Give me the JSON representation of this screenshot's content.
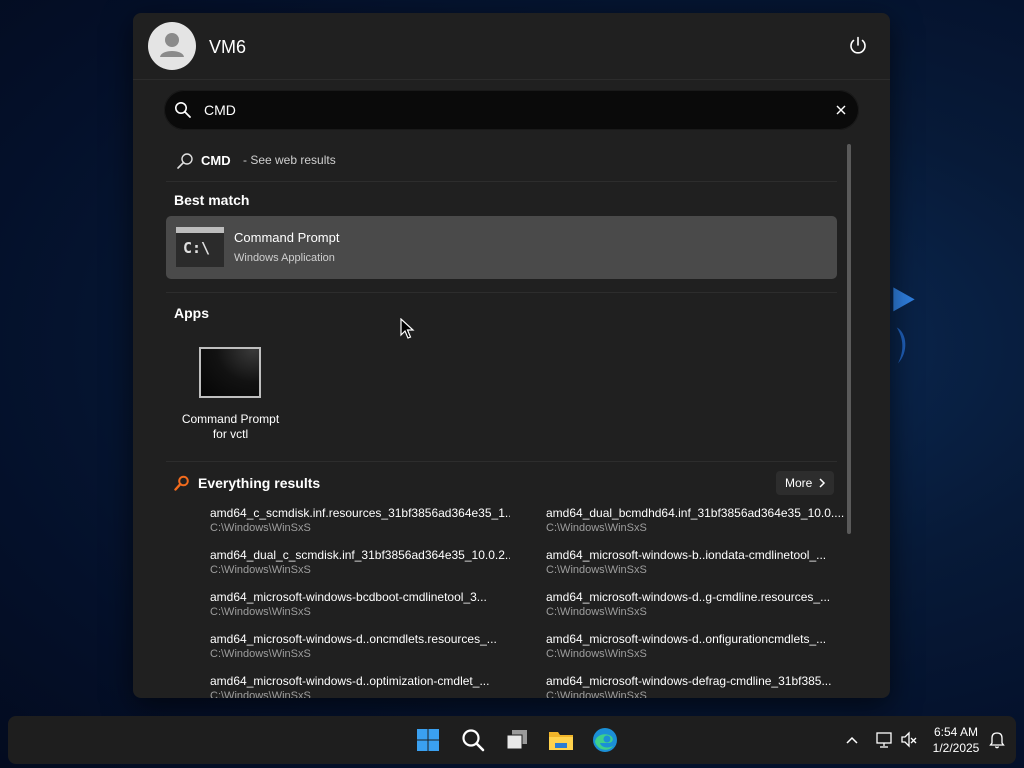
{
  "start_menu": {
    "username": "VM6",
    "search": {
      "query": "CMD"
    },
    "web_result": {
      "term": "CMD",
      "suffix": "- See web results"
    },
    "best_match": {
      "title": "Best match",
      "name": "Command Prompt",
      "type": "Windows Application",
      "icon_glyph": "C:\\"
    },
    "apps": {
      "title": "Apps",
      "items": [
        {
          "line1": "Command Prompt",
          "line2": "for vctl"
        }
      ]
    },
    "everything": {
      "title": "Everything results",
      "more_label": "More",
      "results": [
        {
          "name": "amd64_c_scmdisk.inf.resources_31bf3856ad364e35_1...",
          "path": "C:\\Windows\\WinSxS"
        },
        {
          "name": "amd64_dual_bcmdhd64.inf_31bf3856ad364e35_10.0....",
          "path": "C:\\Windows\\WinSxS"
        },
        {
          "name": "amd64_dual_c_scmdisk.inf_31bf3856ad364e35_10.0.2...",
          "path": "C:\\Windows\\WinSxS"
        },
        {
          "name": "amd64_microsoft-windows-b..iondata-cmdlinetool_...",
          "path": "C:\\Windows\\WinSxS"
        },
        {
          "name": "amd64_microsoft-windows-bcdboot-cmdlinetool_3...",
          "path": "C:\\Windows\\WinSxS"
        },
        {
          "name": "amd64_microsoft-windows-d..g-cmdline.resources_...",
          "path": "C:\\Windows\\WinSxS"
        },
        {
          "name": "amd64_microsoft-windows-d..oncmdlets.resources_...",
          "path": "C:\\Windows\\WinSxS"
        },
        {
          "name": "amd64_microsoft-windows-d..onfigurationcmdlets_...",
          "path": "C:\\Windows\\WinSxS"
        },
        {
          "name": "amd64_microsoft-windows-d..optimization-cmdlet_...",
          "path": "C:\\Windows\\WinSxS"
        },
        {
          "name": "amd64_microsoft-windows-defrag-cmdline_31bf385...",
          "path": "C:\\Windows\\WinSxS"
        }
      ]
    }
  },
  "taskbar": {
    "icons": [
      "windows-start-icon",
      "search-icon",
      "task-view-icon",
      "file-explorer-icon",
      "edge-browser-icon"
    ],
    "tray_icons": [
      "chevron-up-icon",
      "network-icon",
      "volume-muted-icon",
      "notification-bell-icon"
    ],
    "time": "6:54 AM",
    "date": "1/2/2025"
  },
  "colors": {
    "panel_bg": "#202020",
    "selected_card": "#4a4a4a",
    "everything_icon": "#f26b1d",
    "taskbar_bg": "#1e1e1e"
  }
}
